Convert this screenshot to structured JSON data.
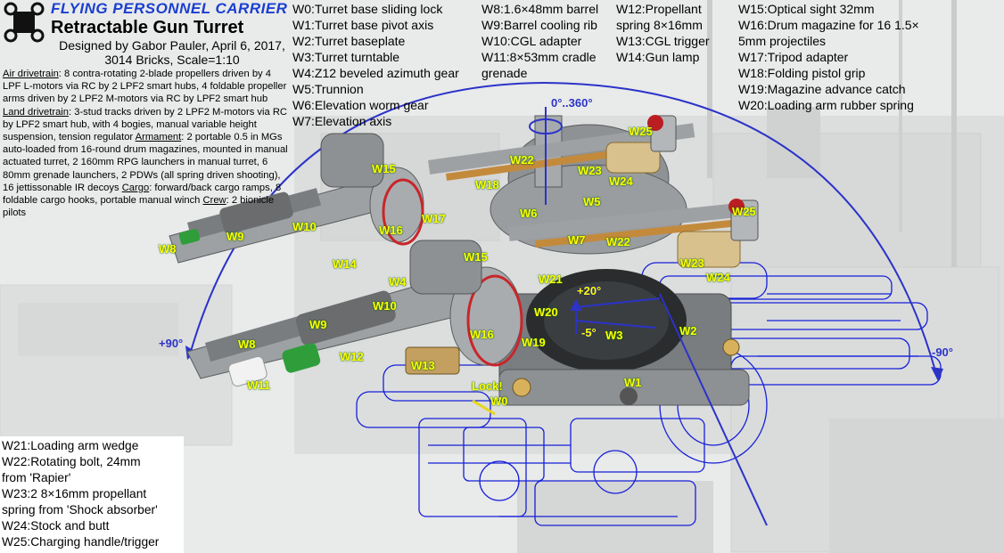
{
  "header": {
    "title_line1": "FLYING PERSONNEL CARRIER",
    "title_line2": "Retractable Gun Turret",
    "designer": "Designed by Gabor Pauler, April 6, 2017, 3014 Bricks, Scale=1:10"
  },
  "description": [
    {
      "label": "Air drivetrain",
      "text": ": 8 contra-rotating 2-blade propellers driven by 4 LPF L-motors via RC by 2 LPF2 smart hubs, 4 foldable propeller arms driven by 2 LPF2 M-motors via RC by LPF2 smart hub "
    },
    {
      "label": "Land drivetrain",
      "text": ": 3-stud tracks driven by 2 LPF2 M-motors via RC by LPF2 smart hub, with 4 bogies, manual variable height suspension, tension regulator "
    },
    {
      "label": "Armament",
      "text": ": 2 portable 0.5 in MGs auto-loaded from 16-round drum magazines, mounted in manual actuated turret, 2 160mm RPG launchers in manual turret, 6 80mm grenade launchers, 2 PDWs (all spring driven shooting), 16 jettissonable IR decoys "
    },
    {
      "label": "Cargo",
      "text": ": forward/back cargo ramps, 8 foldable cargo hooks, portable manual winch "
    },
    {
      "label": "Crew",
      "text": ": 2 bionicle pilots"
    }
  ],
  "legend": {
    "col1": [
      "W0:Turret base sliding lock",
      "W1:Turret base pivot axis",
      "W2:Turret baseplate",
      "W3:Turret turntable",
      "W4:Z12 beveled azimuth gear",
      "W5:Trunnion",
      "W6:Elevation worm gear",
      "W7:Elevation axis"
    ],
    "col2": [
      "W8:1.6×48mm barrel",
      "W9:Barrel cooling rib",
      "W10:CGL adapter",
      "W11:8×53mm cradle"
    ],
    "col2_extra": "grenade",
    "col3": [
      "W12:Propellant",
      "spring 8×16mm",
      "W13:CGL trigger",
      "W14:Gun lamp"
    ],
    "col4": [
      "W15:Optical sight 32mm",
      "W16:Drum magazine for 16 1.5×",
      "5mm projectiles",
      "W17:Tripod adapter",
      "W18:Folding pistol grip",
      "W19:Magazine advance catch",
      "W20:Loading arm rubber spring"
    ],
    "bottom": [
      "W21:Loading arm wedge",
      "W22:Rotating bolt, 24mm",
      "from 'Rapier'",
      "W23:2 8×16mm propellant",
      "spring from 'Shock absorber'",
      "W24:Stock and butt",
      "W25:Charging handle/trigger"
    ]
  },
  "angles": {
    "azimuth": "0°..360°",
    "left": "+90°",
    "right": "-90°",
    "up": "+20°",
    "down": "-5°"
  },
  "parts": [
    "W0",
    "W1",
    "W2",
    "W3",
    "W4",
    "W5",
    "W6",
    "W7",
    "W8",
    "W9",
    "W10",
    "W11",
    "W12",
    "W13",
    "W14",
    "W15",
    "W16",
    "W17",
    "W18",
    "W19",
    "W20",
    "W21",
    "W22",
    "W23",
    "W24",
    "W25"
  ],
  "lock_label": "Lock!",
  "colors": {
    "title_blue": "#1a3fd0",
    "label_yellow": "#ffff00",
    "arc_blue": "#2b33c8"
  }
}
